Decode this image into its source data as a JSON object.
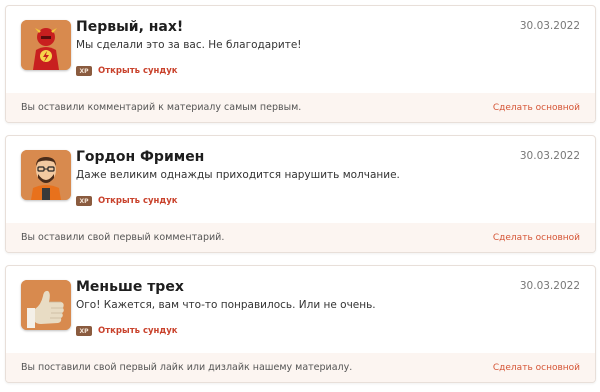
{
  "achievements": [
    {
      "title": "Первый, нах!",
      "description": "Мы сделали это за вас. Не благодарите!",
      "date": "30.03.2022",
      "badge_icon": "flash-hero-icon",
      "xp_label": "XP",
      "chest_label": "Открыть сундук",
      "note": "Вы оставили комментарий к материалу самым первым.",
      "action_label": "Сделать основной"
    },
    {
      "title": "Гордон Фримен",
      "description": "Даже великим однажды приходится нарушить молчание.",
      "date": "30.03.2022",
      "badge_icon": "gordon-freeman-icon",
      "xp_label": "XP",
      "chest_label": "Открыть сундук",
      "note": "Вы оставили свой первый комментарий.",
      "action_label": "Сделать основной"
    },
    {
      "title": "Меньше трех",
      "description": "Ого! Кажется, вам что-то понравилось. Или не очень.",
      "date": "30.03.2022",
      "badge_icon": "thumbs-up-icon",
      "xp_label": "XP",
      "chest_label": "Открыть сундук",
      "note": "Вы поставили свой первый лайк или дизлайк нашему материалу.",
      "action_label": "Сделать основной"
    }
  ],
  "colors": {
    "accent": "#c9422c",
    "link": "#d55536",
    "footer_bg": "#fcf5f1",
    "badge_bg": "#d88a4e"
  }
}
